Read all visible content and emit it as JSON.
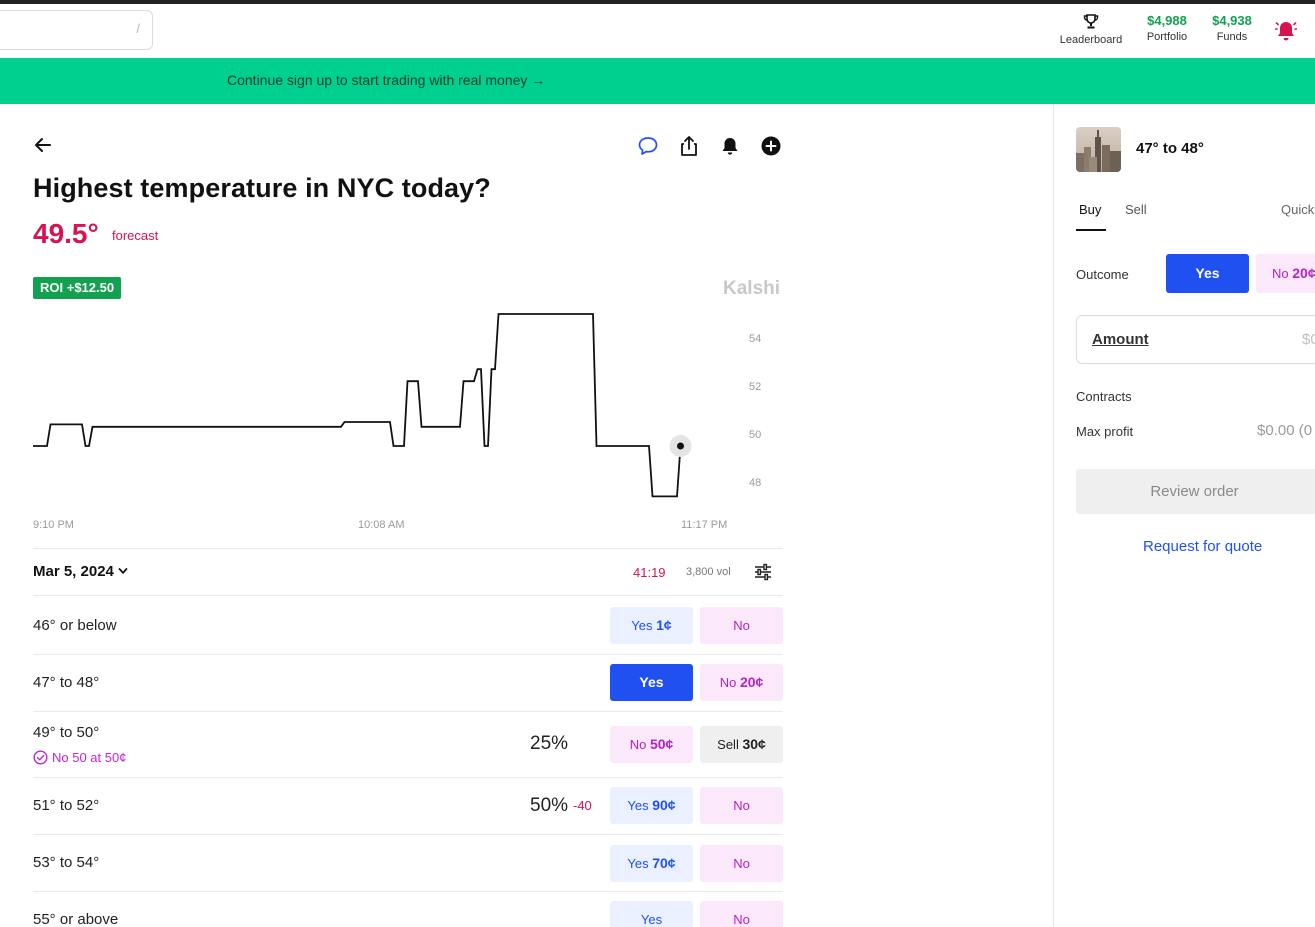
{
  "header": {
    "search_hint": "/",
    "nav": [
      {
        "label": "Leaderboard",
        "icon": "trophy-icon"
      },
      {
        "value": "$4,988",
        "label": "Portfolio"
      },
      {
        "value": "$4,938",
        "label": "Funds"
      }
    ],
    "accent_green": "#12a150"
  },
  "banner": {
    "text": "Continue sign up to start trading with real money →",
    "color": "#00d08f"
  },
  "market": {
    "title": "Highest temperature in NYC today?",
    "forecast_value": "49.5°",
    "forecast_label": "forecast",
    "roi_badge": "ROI +$12.50",
    "watermark": "Kalshi",
    "date": "Mar 5, 2024",
    "countdown": "41:19",
    "volume": "3,800 vol",
    "outcomes": [
      {
        "label": "46° or below",
        "yes": "Yes",
        "yes_price": "1¢",
        "no": "No",
        "no_price": ""
      },
      {
        "label": "47° to 48°",
        "yes": "Yes",
        "yes_price": "",
        "no": "No",
        "no_price": "20¢",
        "selected": true
      },
      {
        "label": "49° to 50°",
        "sub": "No 50 at 50¢",
        "pct": "25%",
        "left_btn": "No",
        "left_price": "50¢",
        "right_btn": "Sell",
        "right_price": "30¢"
      },
      {
        "label": "51° to 52°",
        "pct": "50%",
        "pct_delta": "-40",
        "yes": "Yes",
        "yes_price": "90¢",
        "no": "No",
        "no_price": ""
      },
      {
        "label": "53° to 54°",
        "yes": "Yes",
        "yes_price": "70¢",
        "no": "No",
        "no_price": ""
      },
      {
        "label": "55° or above",
        "yes": "Yes",
        "yes_price": "",
        "no": "No",
        "no_price": ""
      }
    ]
  },
  "trade_panel": {
    "title": "47° to 48°",
    "tabs": [
      "Buy",
      "Sell",
      "Quick"
    ],
    "active_tab": "Buy",
    "outcome_label": "Outcome",
    "yes": "Yes",
    "no": "No",
    "no_price": "20¢",
    "amount_label": "Amount",
    "amount_placeholder": "$0",
    "contracts_label": "Contracts",
    "max_profit_label": "Max profit",
    "max_profit_value": "$0.00 (0",
    "review": "Review order",
    "rfq": "Request for quote"
  },
  "chart_data": {
    "type": "line",
    "title": "",
    "x_tick_labels": [
      "9:10 PM",
      "10:08 AM",
      "11:17 PM"
    ],
    "y_tick_labels": [
      "48",
      "50",
      "52",
      "54"
    ],
    "ylim": [
      47,
      55.5
    ],
    "series": [
      {
        "color": "#111111",
        "x": [
          0,
          2,
          2.5,
          7,
          7.5,
          8,
          8.5,
          44,
          44.5,
          51,
          51.5,
          53,
          53.5,
          55,
          55.5,
          56,
          56.5,
          61,
          61.5,
          63,
          63.5,
          64,
          64.5,
          65,
          65.5,
          66,
          66.5,
          68,
          68.5,
          80,
          80.5,
          88,
          88.5,
          92,
          92.5
        ],
        "y": [
          49.5,
          49.5,
          50.4,
          50.4,
          49.5,
          49.5,
          50.3,
          50.3,
          50.5,
          50.5,
          49.5,
          49.5,
          52.2,
          52.2,
          50.3,
          50.3,
          50.3,
          50.3,
          52.2,
          52.2,
          52.7,
          52.7,
          49.5,
          49.5,
          52.7,
          52.7,
          55.0,
          55.0,
          55.0,
          55.0,
          49.5,
          49.5,
          47.4,
          47.4,
          49.5
        ]
      }
    ],
    "last_point": {
      "x": 92.5,
      "y": 49.5
    },
    "grid": false,
    "y_axis_side": "right"
  }
}
